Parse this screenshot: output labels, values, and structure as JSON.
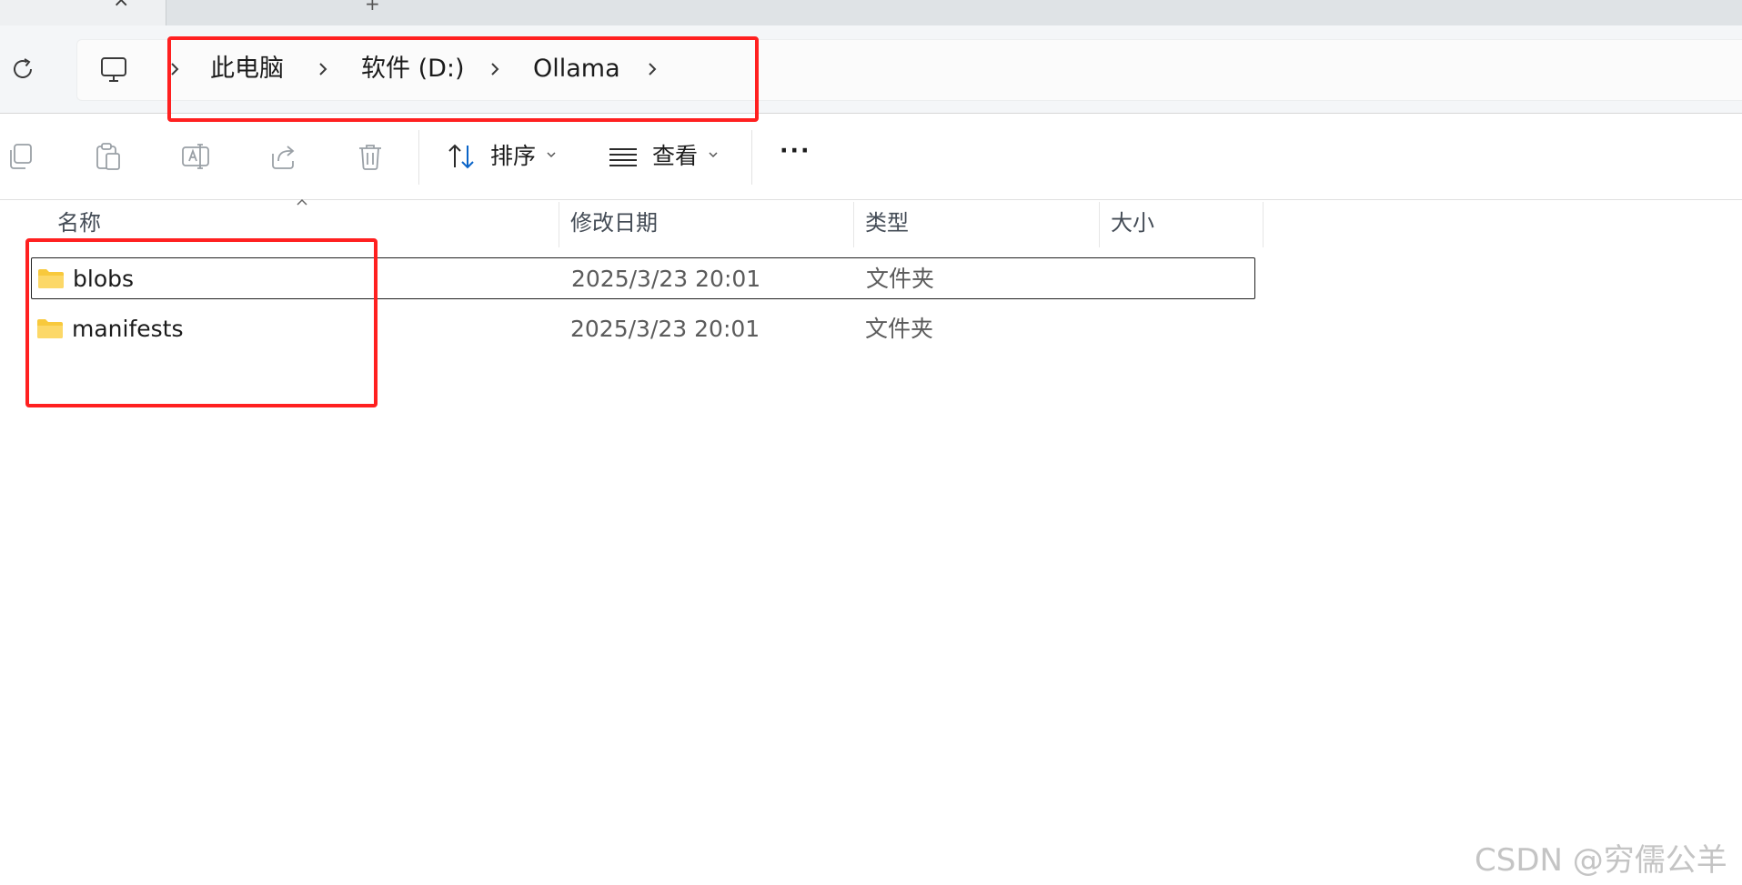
{
  "tabs": {
    "close_glyph": "×",
    "new_tab_glyph": "+"
  },
  "breadcrumb": {
    "items": [
      "此电脑",
      "软件 (D:)",
      "Ollama"
    ],
    "separator": "›"
  },
  "toolbar": {
    "sort_label": "排序",
    "view_label": "查看",
    "more_label": "···"
  },
  "columns": {
    "name": "名称",
    "modified": "修改日期",
    "type": "类型",
    "size": "大小"
  },
  "files": [
    {
      "name": "blobs",
      "modified": "2025/3/23 20:01",
      "type": "文件夹",
      "size": ""
    },
    {
      "name": "manifests",
      "modified": "2025/3/23 20:01",
      "type": "文件夹",
      "size": ""
    }
  ],
  "watermark": "CSDN @穷儒公羊",
  "colors": {
    "highlight": "#ff2020",
    "folder": "#f8c93c",
    "accent": "#0a64c8"
  }
}
